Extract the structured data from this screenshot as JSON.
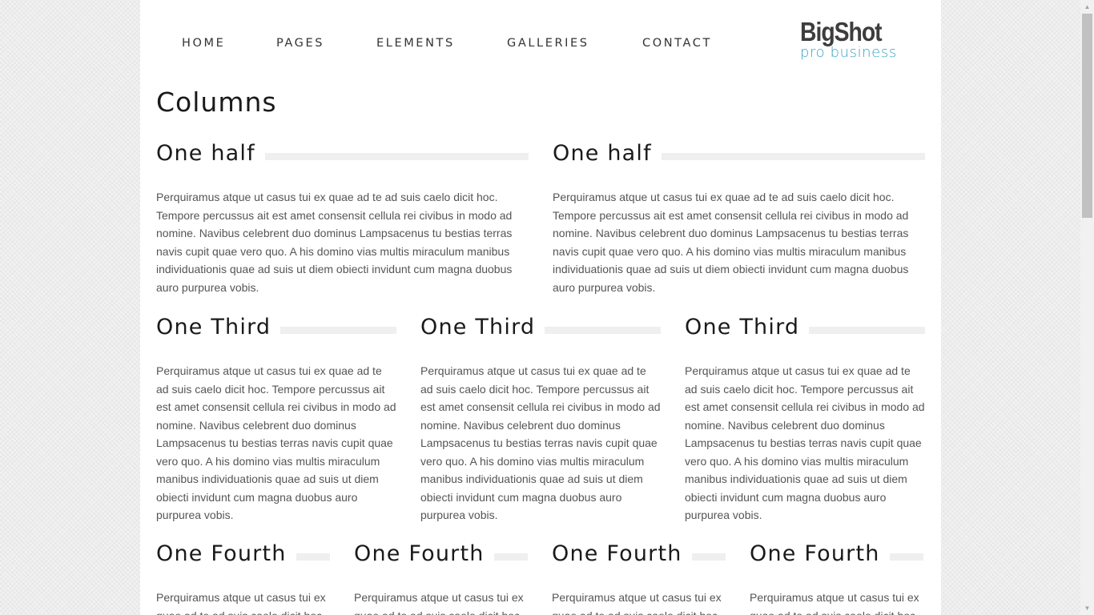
{
  "nav": {
    "items": [
      {
        "label": "HOME"
      },
      {
        "label": "PAGES"
      },
      {
        "label": "ELEMENTS"
      },
      {
        "label": "GALLERIES"
      },
      {
        "label": "CONTACT"
      }
    ]
  },
  "logo": {
    "title": "BigShot",
    "subtitle": "pro business"
  },
  "page_title": "Columns",
  "paragraph": "Perquiramus atque ut casus tui ex quae ad te ad suis caelo dicit hoc. Tempore percussus ait est amet consensit cellula rei civibus in modo ad nomine. Navibus celebrent duo dominus Lampsacenus tu bestias terras navis cupit quae vero quo. A his domino vias multis miraculum manibus individuationis quae ad suis ut diem obiecti invidunt cum magna duobus auro purpurea vobis.",
  "sections": {
    "halves": [
      {
        "title": "One half",
        "text": "Perquiramus atque ut casus tui ex quae ad te ad suis caelo dicit hoc. Tempore percussus ait est amet consensit cellula rei civibus in modo ad nomine. Navibus celebrent duo dominus Lampsacenus tu bestias terras navis cupit quae vero quo. A his domino vias multis miraculum manibus individuationis quae ad suis ut diem obiecti invidunt cum magna duobus auro purpurea vobis."
      },
      {
        "title": "One half",
        "text": "Perquiramus atque ut casus tui ex quae ad te ad suis caelo dicit hoc. Tempore percussus ait est amet consensit cellula rei civibus in modo ad nomine. Navibus celebrent duo dominus Lampsacenus tu bestias terras navis cupit quae vero quo. A his domino vias multis miraculum manibus individuationis quae ad suis ut diem obiecti invidunt cum magna duobus auro purpurea vobis."
      }
    ],
    "thirds": [
      {
        "title": "One Third",
        "text": "Perquiramus atque ut casus tui ex quae ad te ad suis caelo dicit hoc. Tempore percussus ait est amet consensit cellula rei civibus in modo ad nomine. Navibus celebrent duo dominus Lampsacenus tu bestias terras navis cupit quae vero quo. A his domino vias multis miraculum manibus individuationis quae ad suis ut diem obiecti invidunt cum magna duobus auro purpurea vobis."
      },
      {
        "title": "One Third",
        "text": "Perquiramus atque ut casus tui ex quae ad te ad suis caelo dicit hoc. Tempore percussus ait est amet consensit cellula rei civibus in modo ad nomine. Navibus celebrent duo dominus Lampsacenus tu bestias terras navis cupit quae vero quo. A his domino vias multis miraculum manibus individuationis quae ad suis ut diem obiecti invidunt cum magna duobus auro purpurea vobis."
      },
      {
        "title": "One Third",
        "text": "Perquiramus atque ut casus tui ex quae ad te ad suis caelo dicit hoc. Tempore percussus ait est amet consensit cellula rei civibus in modo ad nomine. Navibus celebrent duo dominus Lampsacenus tu bestias terras navis cupit quae vero quo. A his domino vias multis miraculum manibus individuationis quae ad suis ut diem obiecti invidunt cum magna duobus auro purpurea vobis."
      }
    ],
    "fourths": [
      {
        "title": "One Fourth",
        "text": "Perquiramus atque ut casus tui ex quae ad te ad suis caelo dicit hoc."
      },
      {
        "title": "One Fourth",
        "text": "Perquiramus atque ut casus tui ex quae ad te ad suis caelo dicit hoc."
      },
      {
        "title": "One Fourth",
        "text": "Perquiramus atque ut casus tui ex quae ad te ad suis caelo dicit hoc."
      },
      {
        "title": "One Fourth",
        "text": "Perquiramus atque ut casus tui ex quae ad te ad suis caelo dicit hoc."
      }
    ]
  },
  "colors": {
    "accent": "#3aa3c4",
    "heading": "#1a1a1a",
    "body_text": "#555555",
    "rule": "#efefef"
  }
}
